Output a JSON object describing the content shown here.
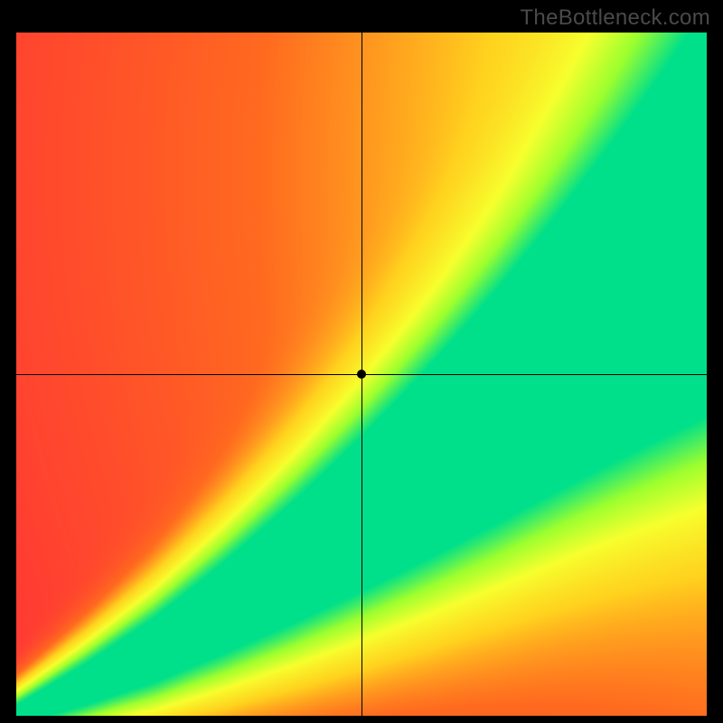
{
  "watermark": "TheBottleneck.com",
  "chart_data": {
    "type": "heatmap",
    "title": "",
    "xlabel": "",
    "ylabel": "",
    "x_range": [
      0,
      1
    ],
    "y_range": [
      0,
      1
    ],
    "marker": {
      "x": 0.5,
      "y": 0.5
    },
    "crosshair": {
      "x": 0.5,
      "y": 0.5
    },
    "optimal_band": {
      "description": "green optimal-match diagonal band from bottom-left to upper-right",
      "center_line": [
        {
          "x": 0.0,
          "y": 0.0
        },
        {
          "x": 0.1,
          "y": 0.045
        },
        {
          "x": 0.2,
          "y": 0.095
        },
        {
          "x": 0.3,
          "y": 0.155
        },
        {
          "x": 0.4,
          "y": 0.22
        },
        {
          "x": 0.5,
          "y": 0.29
        },
        {
          "x": 0.6,
          "y": 0.365
        },
        {
          "x": 0.7,
          "y": 0.445
        },
        {
          "x": 0.8,
          "y": 0.53
        },
        {
          "x": 0.9,
          "y": 0.615
        },
        {
          "x": 1.0,
          "y": 0.7
        }
      ],
      "half_width_start": 0.005,
      "half_width_end": 0.075
    },
    "color_stops": [
      {
        "t": 0.0,
        "color": "#ff1a40"
      },
      {
        "t": 0.35,
        "color": "#ff6a1f"
      },
      {
        "t": 0.55,
        "color": "#ffd21e"
      },
      {
        "t": 0.72,
        "color": "#f7ff2e"
      },
      {
        "t": 0.86,
        "color": "#9dff2e"
      },
      {
        "t": 1.0,
        "color": "#00e08a"
      }
    ]
  }
}
